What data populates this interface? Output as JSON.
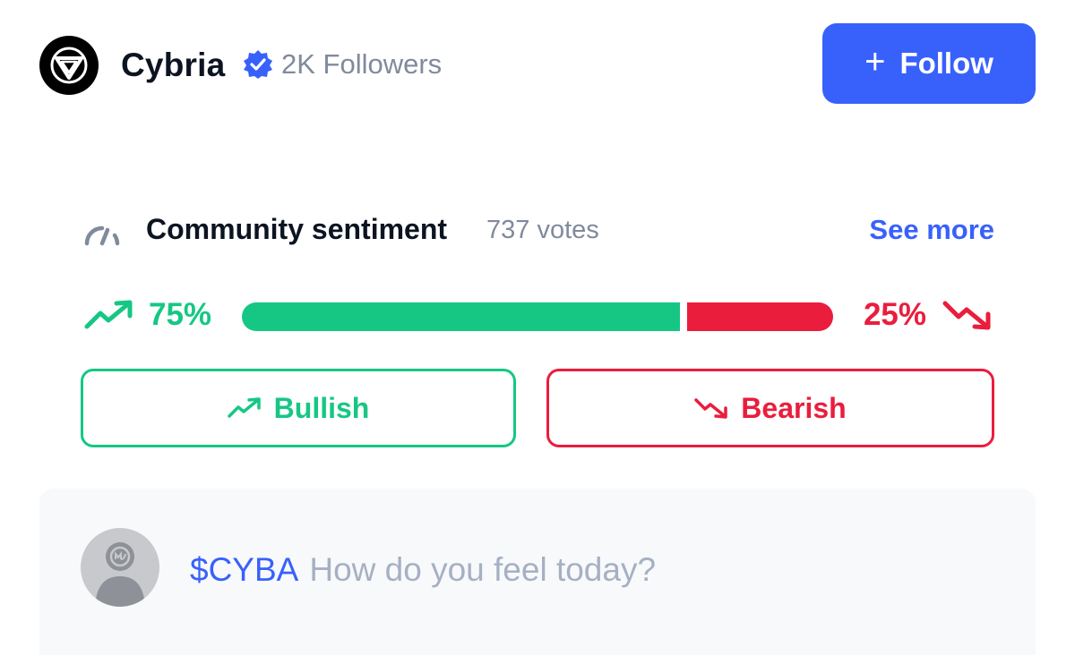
{
  "header": {
    "logo_icon": "cybria-logo-icon",
    "name": "Cybria",
    "verified_icon": "verified-badge-icon",
    "followers": "2K Followers",
    "follow_button": {
      "icon": "plus-icon",
      "plus": "+",
      "label": "Follow"
    }
  },
  "sentiment": {
    "icon": "gauge-icon",
    "title": "Community sentiment",
    "votes": "737 votes",
    "see_more": "See more",
    "bullish_percent_text": "75%",
    "bearish_percent_text": "25%",
    "bullish_fraction": 0.75,
    "bearish_fraction": 0.25,
    "bullish_button": "Bullish",
    "bearish_button": "Bearish"
  },
  "composer": {
    "avatar_icon": "user-avatar-icon",
    "ticker": "$CYBA",
    "placeholder": "How do you feel today?"
  },
  "colors": {
    "accent": "#3861fb",
    "bullish": "#16c784",
    "bearish": "#ea1d3d",
    "muted_text": "#808a9d"
  }
}
